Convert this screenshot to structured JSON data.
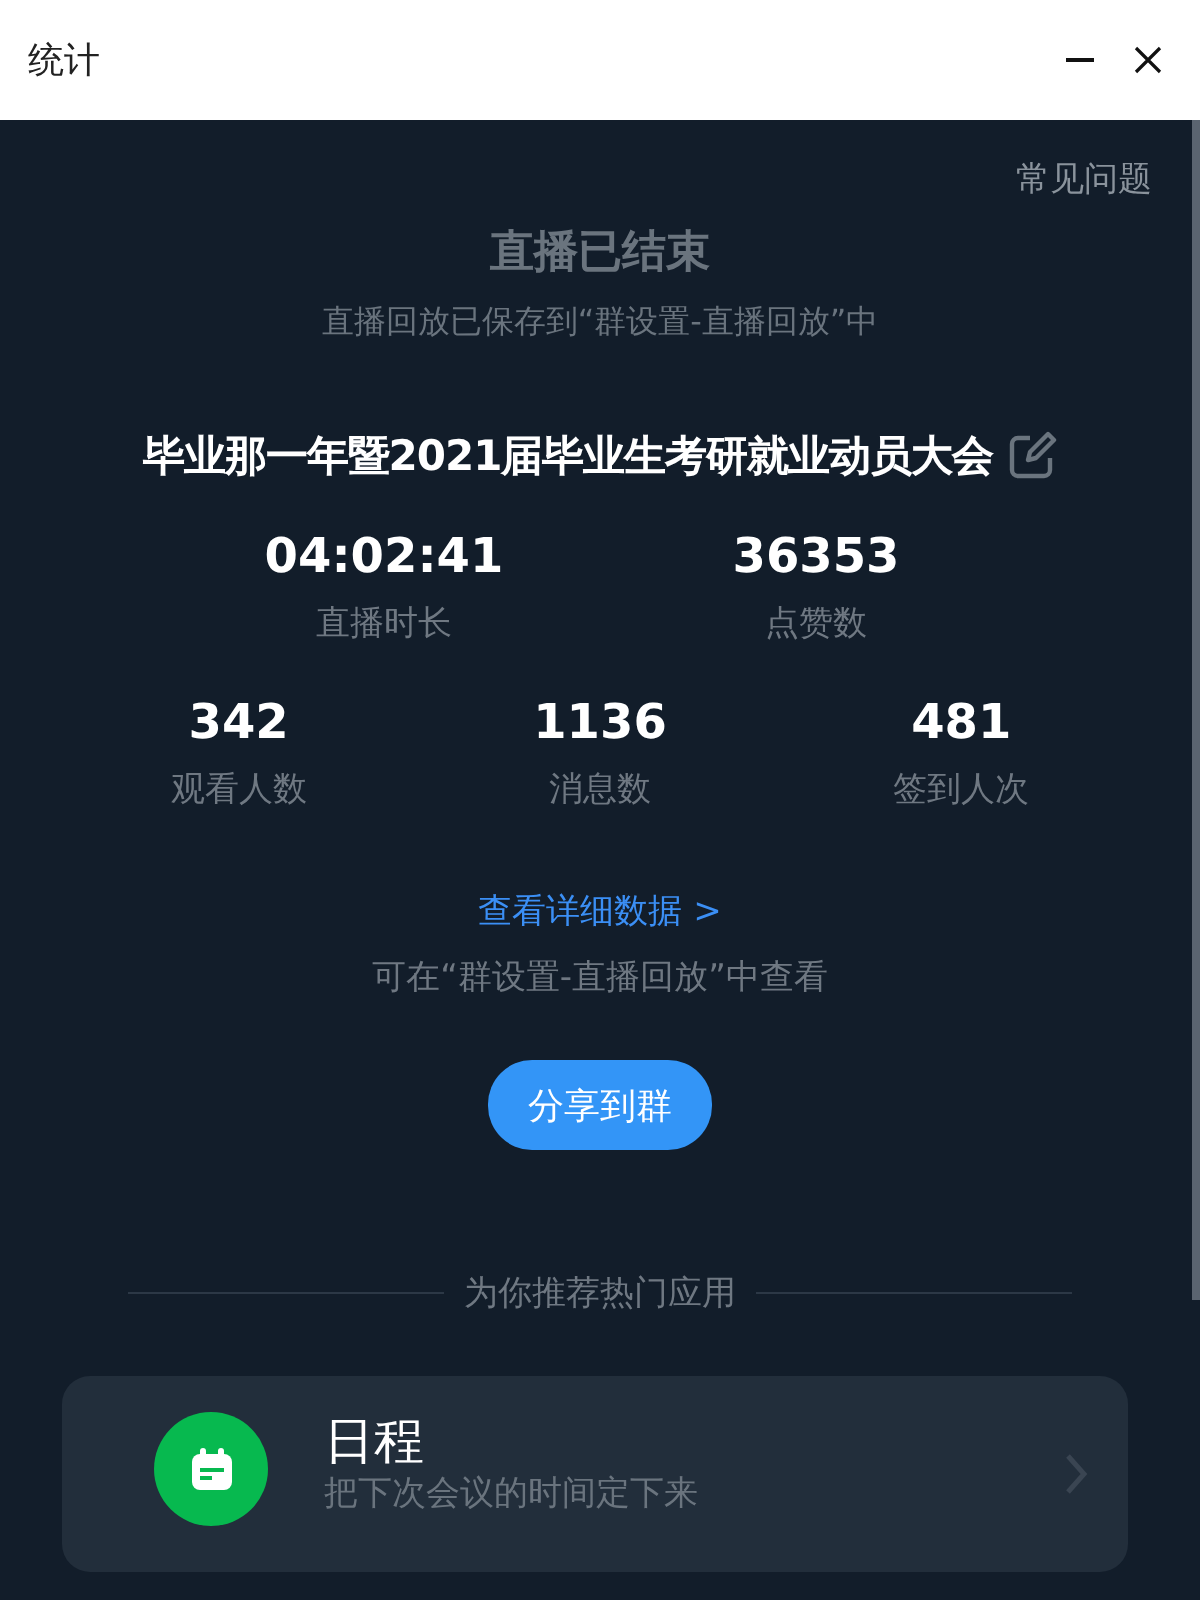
{
  "window": {
    "title": "统计"
  },
  "faq_link": "常见问题",
  "status": {
    "title": "直播已结束",
    "subtitle": "直播回放已保存到“群设置-直播回放”中"
  },
  "meeting_title": "毕业那一年暨2021届毕业生考研就业动员大会",
  "stats_primary": [
    {
      "value": "04:02:41",
      "label": "直播时长"
    },
    {
      "value": "36353",
      "label": "点赞数"
    }
  ],
  "stats_secondary": [
    {
      "value": "342",
      "label": "观看人数"
    },
    {
      "value": "1136",
      "label": "消息数"
    },
    {
      "value": "481",
      "label": "签到人次"
    }
  ],
  "details_link": "查看详细数据 >",
  "details_note": "可在“群设置-直播回放”中查看",
  "share_button": "分享到群",
  "recommend_heading": "为你推荐热门应用",
  "apps": [
    {
      "name": "日程",
      "description": "把下次会议的时间定下来",
      "color": "#07b94f"
    }
  ]
}
